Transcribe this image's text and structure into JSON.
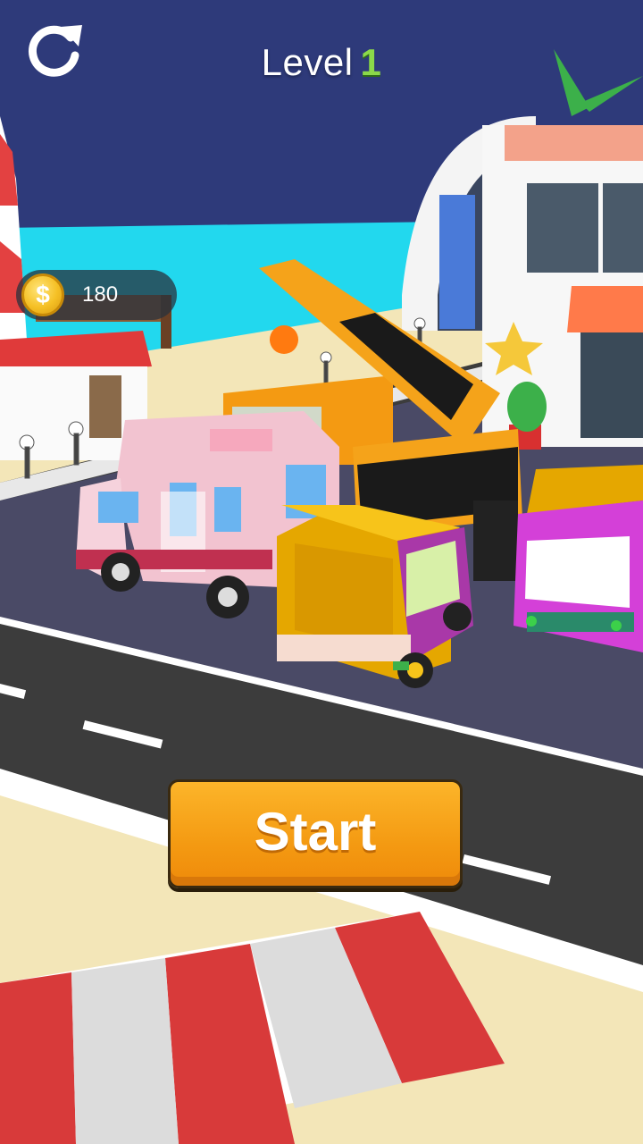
{
  "hud": {
    "reload_icon": "reload-icon",
    "level_label": "Level",
    "level_number": "1",
    "coins": "180",
    "coin_symbol": "$",
    "coin_icon": "dollar-coin-icon"
  },
  "start_button": {
    "label": "Start"
  },
  "colors": {
    "sky": "#2e3a7a",
    "sea": "#22d8ee",
    "road": "#3c3c3c",
    "sand": "#f3e6b8",
    "start_button": "#f7a51a",
    "level_number": "#8bd94a"
  }
}
